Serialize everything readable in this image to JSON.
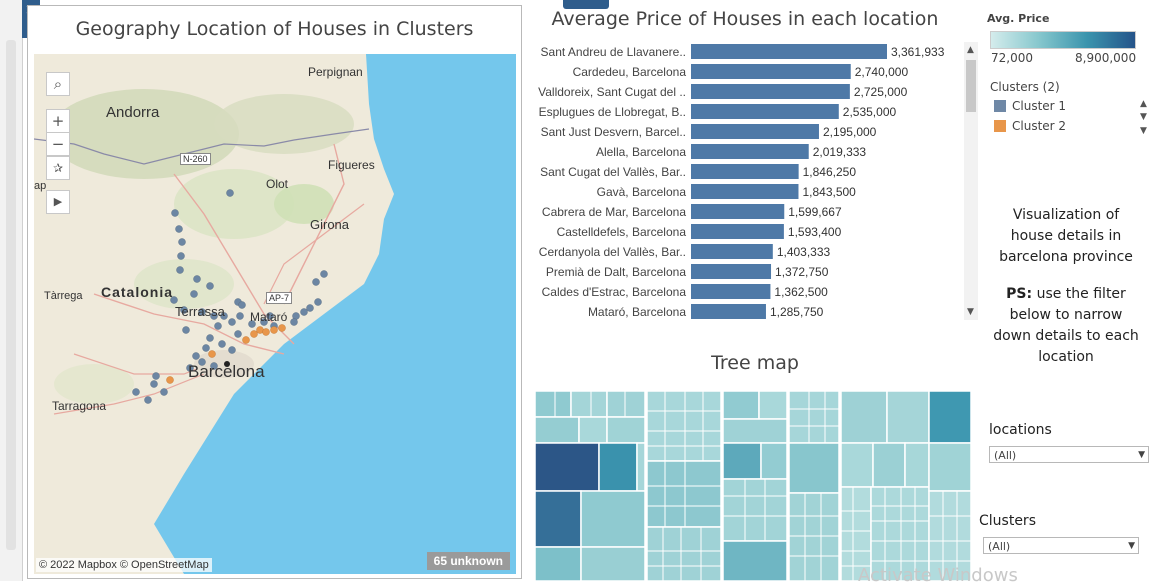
{
  "toolbar": {
    "close_glyph": "✕",
    "menu_glyph": "▾"
  },
  "map": {
    "title": "Geography Location of Houses in Clusters",
    "attribution": "© 2022 Mapbox © OpenStreetMap",
    "unknown_badge": "65 unknown",
    "place_labels": {
      "perpignan": "Perpignan",
      "andorra": "Andorra",
      "n260": "N-260",
      "figueres": "Figueres",
      "olot": "Olot",
      "girona": "Girona",
      "catalonia": "Catalonia",
      "tarrega": "Tàrrega",
      "terrassa": "Terrassa",
      "ap7": "AP-7",
      "mataro": "Mataró",
      "barcelona": "Barcelona",
      "tarragona": "Tarragona",
      "cut_label": "ap"
    },
    "icons": {
      "search": "search-icon",
      "zoom_in": "plus-icon",
      "zoom_out": "minus-icon",
      "pin": "pin-icon",
      "play": "play-icon"
    },
    "cluster_colors": {
      "cluster1": "#6c86a3",
      "cluster2": "#e8964a"
    }
  },
  "bar_chart": {
    "title": "Average Price of Houses in each location"
  },
  "chart_data": {
    "type": "bar",
    "categories": [
      "Sant Andreu de Llavanere..",
      "Cardedeu, Barcelona",
      "Valldoreix, Sant Cugat del ..",
      "Esplugues de Llobregat, B..",
      "Sant Just Desvern, Barcel..",
      "Alella, Barcelona",
      "Sant Cugat del Vallès, Bar..",
      "Gavà, Barcelona",
      "Cabrera de Mar, Barcelona",
      "Castelldefels, Barcelona",
      "Cerdanyola del Vallès, Bar..",
      "Premià de Dalt, Barcelona",
      "Caldes d'Estrac, Barcelona",
      "Mataró, Barcelona"
    ],
    "values": [
      3361933,
      2740000,
      2725000,
      2535000,
      2195000,
      2019333,
      1846250,
      1843500,
      1599667,
      1593400,
      1403333,
      1372750,
      1362500,
      1285750
    ],
    "value_labels": [
      "3,361,933",
      "2,740,000",
      "2,725,000",
      "2,535,000",
      "2,195,000",
      "2,019,333",
      "1,846,250",
      "1,843,500",
      "1,599,667",
      "1,593,400",
      "1,403,333",
      "1,372,750",
      "1,362,500",
      "1,285,750"
    ],
    "title": "Average Price of Houses in each location",
    "bar_color": "#4e79a7"
  },
  "legend": {
    "price_title": "Avg. Price",
    "price_min": "72,000",
    "price_max": "8,900,000",
    "clusters_title": "Clusters (2)",
    "cluster1_label": "Cluster 1",
    "cluster2_label": "Cluster 2",
    "cluster1_color": "#6f88a6",
    "cluster2_color": "#e8964a"
  },
  "description": {
    "line1": "Visualization  of house details in barcelona province",
    "ps_prefix": "PS:",
    "line2": " use the filter below to narrow down details to each location"
  },
  "tree_map": {
    "title": "Tree map"
  },
  "filters": {
    "locations_title": "locations",
    "locations_value": "(All)",
    "clusters_title": "Clusters",
    "clusters_value": "(All)"
  },
  "watermark": "Activate Windows"
}
